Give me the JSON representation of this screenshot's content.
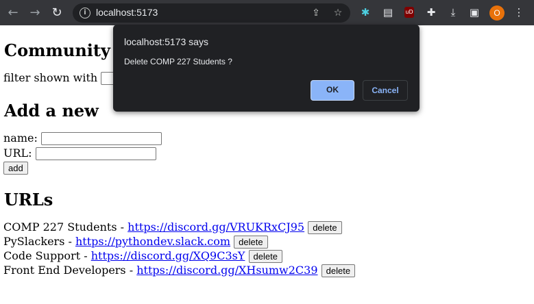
{
  "browser": {
    "url": "localhost:5173",
    "profile_initial": "O",
    "extension_ublock_label": "uD"
  },
  "page": {
    "heading": "Community Dir",
    "filter_label": "filter shown with",
    "add_heading": "Add a new",
    "name_label": "name:",
    "url_label": "URL:",
    "add_button": "add",
    "urls_heading": "URLs",
    "entries": [
      {
        "name": "COMP 227 Students",
        "sep": " - ",
        "link": "https://discord.gg/VRUKRxCJ95",
        "button": "delete"
      },
      {
        "name": "PySlackers",
        "sep": " - ",
        "link": "https://pythondev.slack.com",
        "button": "delete"
      },
      {
        "name": "Code Support",
        "sep": " - ",
        "link": "https://discord.gg/XQ9C3sY",
        "button": "delete"
      },
      {
        "name": "Front End Developers",
        "sep": " - ",
        "link": "https://discord.gg/XHsumw2C39",
        "button": "delete"
      }
    ]
  },
  "dialog": {
    "title": "localhost:5173 says",
    "message": "Delete COMP 227 Students ?",
    "ok": "OK",
    "cancel": "Cancel"
  }
}
